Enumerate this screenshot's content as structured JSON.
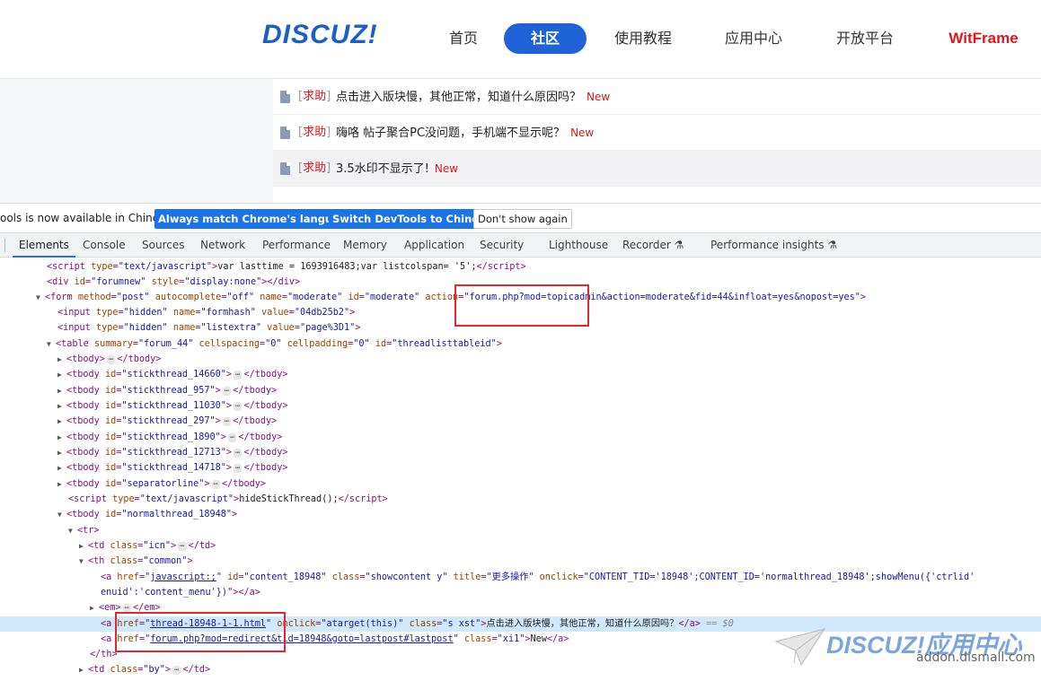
{
  "header": {
    "logo": "DISCUZ!",
    "nav": [
      "首页",
      "社区",
      "使用教程",
      "应用中心",
      "开放平台"
    ],
    "brand": "WitFrame",
    "active_nav": "社区"
  },
  "threads": [
    {
      "tag": "求助",
      "title": "点击进入版块慢，其他正常，知道什么原因吗？",
      "badge": "New"
    },
    {
      "tag": "求助",
      "title": "嗨咯 帖子聚合PC没问题，手机端不显示呢？",
      "badge": "New"
    },
    {
      "tag": "求助",
      "title": "3.5水印不显示了!",
      "badge": "New"
    }
  ],
  "infobar": {
    "message": "ools is now available in Chinese!",
    "btn_match": "Always match Chrome's language",
    "btn_switch": "Switch DevTools to Chinese",
    "btn_dismiss": "Don't show again"
  },
  "devtools_tabs": [
    "Elements",
    "Console",
    "Sources",
    "Network",
    "Performance",
    "Memory",
    "Application",
    "Security",
    "Lighthouse",
    "Recorder",
    "Performance insights"
  ],
  "code": {
    "l1_script": "var lasttime = 1693916483;var listcolspan= '5';",
    "l2_id": "\"forumnew\"",
    "l2_style": "\"display:none\"",
    "form_method": "\"post\"",
    "form_auto": "\"off\"",
    "form_name": "\"moderate\"",
    "form_id": "\"moderate\"",
    "form_action": "\"forum.php?mod=topicadmin&action=moderate&fid=44&infloat=yes&nopost=yes\"",
    "formhash": "\"04db25b2\"",
    "listextra": "\"page%3D1\"",
    "table_summary": "\"forum_44\"",
    "table_cs": "\"0\"",
    "table_cp": "\"0\"",
    "table_id": "\"threadlisttableid\"",
    "stick_ids": [
      "\"stickthread_14660\"",
      "\"stickthread_957\"",
      "\"stickthread_11030\"",
      "\"stickthread_297\"",
      "\"stickthread_1890\"",
      "\"stickthread_12713\"",
      "\"stickthread_14718\"",
      "\"separatorline\""
    ],
    "hide_script": "hideStickThread();",
    "normal_id": "\"normalthread_18948\"",
    "td_icn": "\"icn\"",
    "th_common": "\"common\"",
    "a1_href": "javascript:;",
    "a1_id": "\"content_18948\"",
    "a1_class": "\"showcontent y\"",
    "a1_title": "\"更多操作\"",
    "a1_onclick": "\"CONTENT_TID='18948';CONTENT_ID='normalthread_18948';showMenu({'ctrlid'",
    "a1_cont": "enuid':'content_menu'})\"",
    "a2_href": "thread-18948-1-1.html",
    "a2_onclick": "\"atarget(this)\"",
    "a2_class": "\"s xst\"",
    "a2_text": "点击进入版块慢，其他正常，知道什么原因吗？",
    "a2_marker": "== $0",
    "a3_href": "forum.php?mod=redirect&tid=18948&goto=lastpost#lastpost",
    "a3_class": "\"xi1\"",
    "a3_text": "New",
    "td_by": "\"by\""
  },
  "watermark": {
    "logo": "DISCUZ!应用中心",
    "url": "addon.dismall.com"
  },
  "colors": {
    "brand_blue": "#1e63d8",
    "accent_red": "#e0161b",
    "highlight": "#cfe8fc"
  }
}
